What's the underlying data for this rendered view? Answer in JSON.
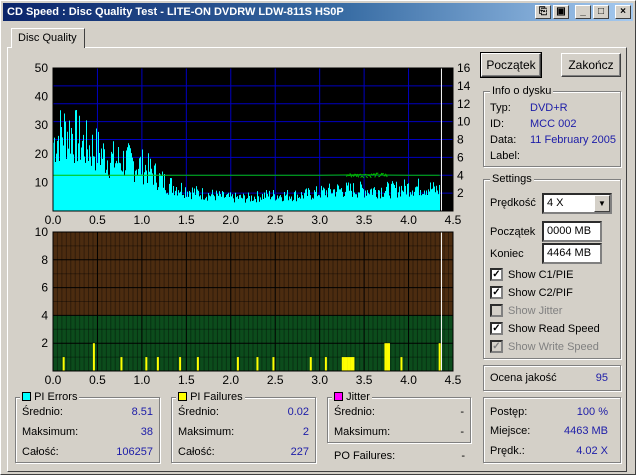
{
  "window": {
    "title": "CD Speed : Disc Quality Test - LITE-ON DVDRW LDW-811S   HS0P",
    "tab": "Disc Quality",
    "buttons": {
      "start": "Początek",
      "exit": "Zakończ"
    }
  },
  "info": {
    "title": "Info o dysku",
    "type_label": "Typ:",
    "type_value": "DVD+R",
    "id_label": "ID:",
    "id_value": "MCC 002",
    "date_label": "Data:",
    "date_value": "11 February 2005",
    "disc_label": "Label:",
    "disc_value": ""
  },
  "settings": {
    "title": "Settings",
    "speed_label": "Prędkość",
    "speed_value": "4 X",
    "start_label": "Początek",
    "start_value": "0000 MB",
    "end_label": "Koniec",
    "end_value": "4464 MB",
    "checks": [
      {
        "label": "Show C1/PIE",
        "checked": "✓",
        "disabled": false
      },
      {
        "label": "Show C2/PIF",
        "checked": "✓",
        "disabled": false
      },
      {
        "label": "Show Jitter",
        "checked": "",
        "disabled": true
      },
      {
        "label": "Show Read Speed",
        "checked": "✓",
        "disabled": false
      },
      {
        "label": "Show Write Speed",
        "checked": "✓",
        "disabled": true
      }
    ]
  },
  "quality": {
    "label": "Ocena jakość",
    "value": "95"
  },
  "progress": {
    "progress_label": "Postęp:",
    "progress_value": "100 %",
    "position_label": "Miejsce:",
    "position_value": "4463 MB",
    "speed_label": "Prędk.:",
    "speed_value": "4.02 X"
  },
  "pi_errors": {
    "title": "PI Errors",
    "color": "#00ffff",
    "avg_label": "Średnio:",
    "avg_value": "8.51",
    "max_label": "Maksimum:",
    "max_value": "38",
    "total_label": "Całość:",
    "total_value": "106257"
  },
  "pi_failures": {
    "title": "PI Failures",
    "color": "#ffff00",
    "avg_label": "Średnio:",
    "avg_value": "0.02",
    "max_label": "Maksimum:",
    "max_value": "2",
    "total_label": "Całość:",
    "total_value": "227"
  },
  "jitter": {
    "title": "Jitter",
    "color": "#ff00ff",
    "avg_label": "Średnio:",
    "avg_value": "-",
    "max_label": "Maksimum:",
    "max_value": "-",
    "po_label": "PO Failures:",
    "po_value": "-"
  },
  "chart_data": [
    {
      "type": "area",
      "name": "PI Errors / Read Speed",
      "xlim": [
        0.0,
        4.5
      ],
      "ylim_left": [
        0,
        50
      ],
      "ylim_right": [
        0,
        16
      ],
      "x_ticks": [
        "0.0",
        "0.5",
        "1.0",
        "1.5",
        "2.0",
        "2.5",
        "3.0",
        "3.5",
        "4.0",
        "4.5"
      ],
      "y_ticks_left": [
        "10",
        "20",
        "30",
        "40",
        "50"
      ],
      "y_ticks_right": [
        "2",
        "4",
        "6",
        "8",
        "10",
        "12",
        "14",
        "16"
      ],
      "series": [
        {
          "name": "PI Errors",
          "color": "#00ffff",
          "x": [
            0.0,
            0.1,
            0.2,
            0.3,
            0.4,
            0.5,
            0.6,
            0.7,
            0.8,
            0.9,
            1.0,
            1.1,
            1.2,
            1.3,
            1.4,
            1.5,
            1.6,
            1.8,
            2.0,
            2.2,
            2.4,
            2.6,
            2.8,
            3.0,
            3.2,
            3.4,
            3.6,
            3.8,
            4.0,
            4.2,
            4.3,
            4.35
          ],
          "values": [
            26,
            30,
            30,
            26,
            24,
            23,
            20,
            19,
            19,
            18,
            17,
            15,
            12,
            10,
            9,
            8,
            7,
            6,
            5,
            5,
            6,
            6,
            6,
            7,
            8,
            8,
            8,
            8,
            9,
            9,
            8,
            8
          ]
        },
        {
          "name": "Read Speed",
          "color": "#00c000",
          "x": [
            0.0,
            0.5,
            1.0,
            1.5,
            2.0,
            2.5,
            3.0,
            3.5,
            4.0,
            4.35
          ],
          "values": [
            4.0,
            4.0,
            4.0,
            4.0,
            4.0,
            4.0,
            4.0,
            4.05,
            4.0,
            4.0
          ]
        }
      ]
    },
    {
      "type": "bar",
      "name": "PI Failures",
      "xlim": [
        0.0,
        4.5
      ],
      "ylim": [
        0,
        10
      ],
      "x_ticks": [
        "0.0",
        "0.5",
        "1.0",
        "1.5",
        "2.0",
        "2.5",
        "3.0",
        "3.5",
        "4.0",
        "4.5"
      ],
      "y_ticks": [
        "2",
        "4",
        "6",
        "8",
        "10"
      ],
      "series": [
        {
          "name": "PI Failures",
          "color": "#ffff00",
          "x": [
            0.12,
            0.46,
            0.77,
            1.05,
            1.18,
            1.43,
            1.63,
            2.08,
            2.3,
            2.48,
            2.9,
            3.07,
            3.26,
            3.28,
            3.3,
            3.32,
            3.34,
            3.36,
            3.38,
            3.74,
            3.76,
            3.78,
            3.92,
            4.35
          ],
          "values": [
            1,
            2,
            1,
            1,
            1,
            1,
            1,
            1,
            1,
            1,
            1,
            1,
            1,
            1,
            1,
            1,
            1,
            1,
            1,
            2,
            2,
            2,
            1,
            2
          ]
        }
      ]
    }
  ]
}
